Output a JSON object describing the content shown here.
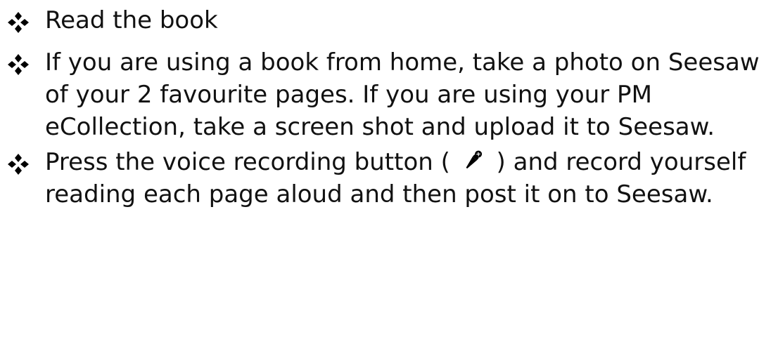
{
  "items": [
    {
      "text": "Read the book"
    },
    {
      "text": "If you are using a book from home, take a photo on Seesaw of your 2 favourite pages. If you are using your PM eCollection, take a screen shot and upload it to Seesaw."
    },
    {
      "text_before": "Press the voice recording button (",
      "icon": "microphone-icon",
      "text_after": ") and record yourself reading each page aloud and then post it on to Seesaw."
    }
  ],
  "colors": {
    "text": "#111111",
    "bullet": "#000000"
  }
}
